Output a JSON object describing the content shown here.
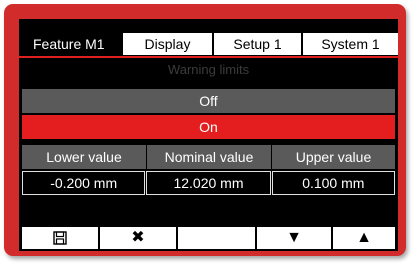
{
  "tabs": [
    {
      "label": "Feature  M1",
      "active": true
    },
    {
      "label": "Display",
      "active": false
    },
    {
      "label": "Setup 1",
      "active": false
    },
    {
      "label": "System 1",
      "active": false
    }
  ],
  "section_title": "Warning limits",
  "options": {
    "off": "Off",
    "on": "On",
    "selected": "On"
  },
  "table": {
    "headers": [
      "Lower value",
      "Nominal value",
      "Upper value"
    ],
    "values": [
      "-0.200 mm",
      "12.020 mm",
      "0.100 mm"
    ]
  },
  "buttons": {
    "save_icon": "save-icon",
    "cancel_icon": "close-icon",
    "blank": "",
    "down_icon": "arrow-down-icon",
    "up_icon": "arrow-up-icon",
    "cancel_glyph": "✖",
    "down_glyph": "▼",
    "up_glyph": "▲"
  },
  "colors": {
    "frame": "#d22b2b",
    "accent_red": "#e41e1e",
    "gray": "#5a5a5a",
    "title_dim": "#3c3c3c"
  }
}
